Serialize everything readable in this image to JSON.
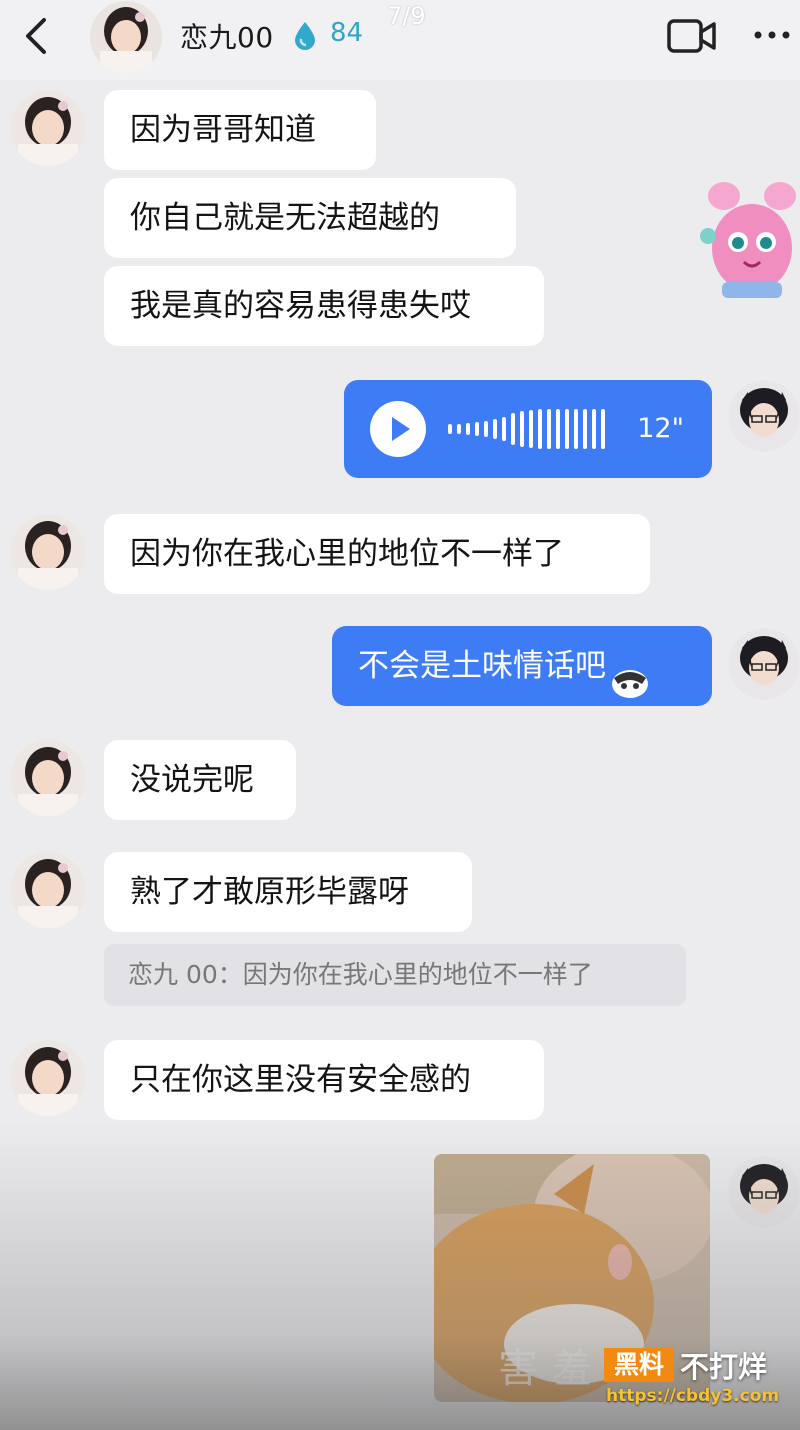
{
  "header": {
    "contact_name": "恋九00",
    "heat_count": "84",
    "page_indicator": "7/9"
  },
  "messages": {
    "m1": "因为哥哥知道",
    "m2": "你自己就是无法超越的",
    "m3": "我是真的容易患得患失哎",
    "voice_duration": "12\"",
    "m4": "因为你在我心里的地位不一样了",
    "m5": "不会是土味情话吧",
    "m6": "没说完呢",
    "m7": "熟了才敢原形毕露呀",
    "quote": "恋九 00：因为你在我心里的地位不一样了",
    "m8": "只在你这里没有安全感的",
    "photo_caption": "害羞"
  },
  "watermark": {
    "box_text": "黑料",
    "text": "不打烊",
    "url": "https://cbdy3.com"
  },
  "colors": {
    "bubble_blue": "#3e7cf5",
    "background": "#ececef",
    "heat": "#2fa6c8"
  },
  "icons": [
    "back-arrow-icon",
    "heat-drop-icon",
    "video-call-icon",
    "more-icon",
    "play-icon",
    "waveform-icon",
    "sticker",
    "emoji"
  ]
}
